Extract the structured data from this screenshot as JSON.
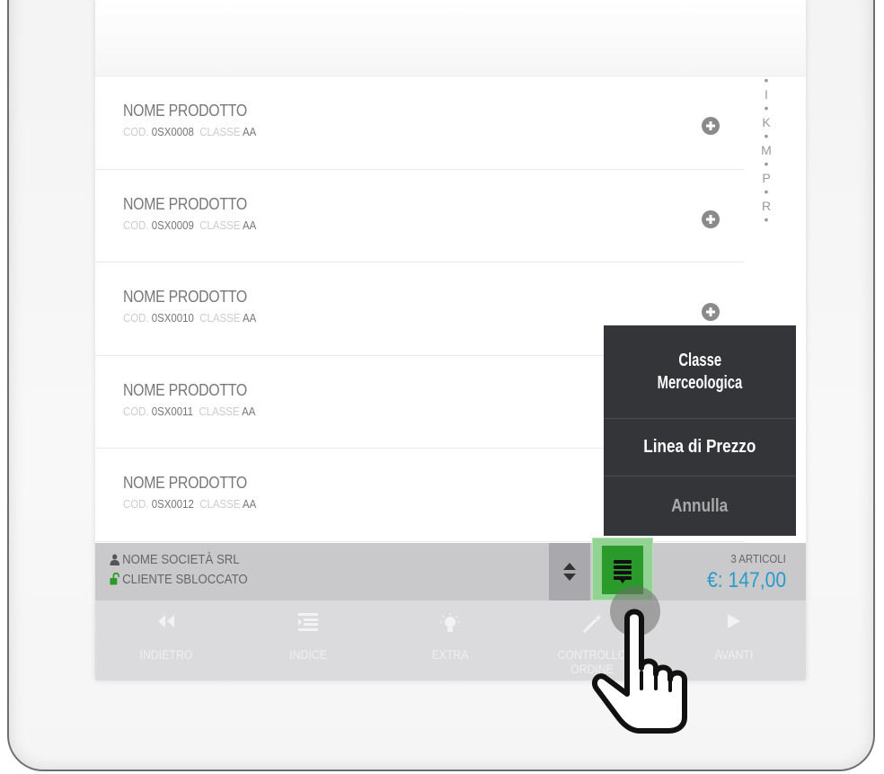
{
  "products": [
    {
      "name": "NOME PRODOTTO",
      "cod_label": "COD.",
      "cod": "0SX0008",
      "class_label": "CLASSE",
      "class": "AA"
    },
    {
      "name": "NOME PRODOTTO",
      "cod_label": "COD.",
      "cod": "0SX0009",
      "class_label": "CLASSE",
      "class": "AA"
    },
    {
      "name": "NOME PRODOTTO",
      "cod_label": "COD.",
      "cod": "0SX0010",
      "class_label": "CLASSE",
      "class": "AA"
    },
    {
      "name": "NOME PRODOTTO",
      "cod_label": "COD.",
      "cod": "0SX0011",
      "class_label": "CLASSE",
      "class": "AA"
    },
    {
      "name": "NOME PRODOTTO",
      "cod_label": "COD.",
      "cod": "0SX0012",
      "class_label": "CLASSE",
      "class": "AA"
    }
  ],
  "alpha_index": [
    "•",
    "I",
    "•",
    "K",
    "•",
    "M",
    "•",
    "P",
    "•",
    "R",
    "•"
  ],
  "popup": {
    "item1_line1": "Classe",
    "item1_line2": "Merceologica",
    "item2": "Linea di Prezzo",
    "cancel": "Annulla"
  },
  "customer": {
    "name": "NOME SOCIETÀ SRL",
    "status": "CLIENTE SBLOCCATO"
  },
  "totals": {
    "count": "3 ARTICOLI",
    "amount": "€: 147,00"
  },
  "nav": {
    "back": "INDIETRO",
    "index": "INDICE",
    "extra": "EXTRA",
    "check_line1": "CONTROLLO",
    "check_line2": "ORDINE",
    "next": "AVANTI"
  },
  "colors": {
    "popup_bg": "#333538",
    "amount": "#2a9ac9",
    "unlock": "#2a9a2a",
    "active_button": "#2a9a2a"
  },
  "icons": [
    "plus-circle-icon",
    "user-icon",
    "unlocked-padlock-icon",
    "sort-arrows-icon",
    "list-icon",
    "rewind-icon",
    "index-icon",
    "lightbulb-icon",
    "magic-wand-icon",
    "play-icon",
    "hand-pointer-icon"
  ]
}
